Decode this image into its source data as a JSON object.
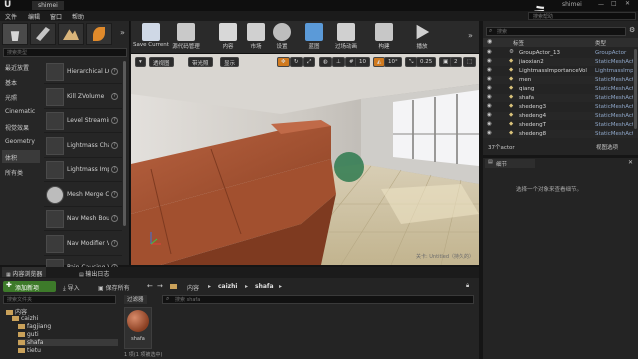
{
  "window": {
    "title": "shimei",
    "logo": "ue-logo"
  },
  "menu": [
    "文件",
    "编辑",
    "窗口",
    "帮助"
  ],
  "top_right": {
    "title": "shimei",
    "search_placeholder": "搜索帮助"
  },
  "modes_panel": {
    "search_placeholder": "搜索类型",
    "categories": [
      "最近放置",
      "基本",
      "光照",
      "Cinematic",
      "视觉效果",
      "Geometry",
      "体积",
      "所有类"
    ],
    "active_category_index": 6,
    "items": [
      "Hierarchical LOD",
      "Kill ZVolume",
      "Level Streamin",
      "Lightmass Cha",
      "Lightmass Imp",
      "Mesh Merge Cullin",
      "Nav Mesh Bou",
      "Nav Modifier V",
      "Pain Causing V"
    ]
  },
  "toolbar": {
    "buttons": [
      "Save Current",
      "源代码管理",
      "内容",
      "市场",
      "设置",
      "蓝图",
      "过场动画",
      "构建",
      "播放"
    ]
  },
  "viewport": {
    "view_mode": "透视图",
    "lit_mode": "带光照",
    "show": "显示",
    "grid_snap": "10",
    "rotate_snap": "10°",
    "scale_snap": "0.25",
    "camera_speed": "2",
    "watermark": "关卡: Untitled（持久的）"
  },
  "outliner": {
    "search_placeholder": "搜索",
    "col_label": "标签",
    "col_type": "类型",
    "rows": [
      {
        "label": "GroupActor_13",
        "type": "GroupActor"
      },
      {
        "label": "jiaoxian2",
        "type": "StaticMeshAct"
      },
      {
        "label": "LightmassImportanceVol",
        "type": "LightmassImp"
      },
      {
        "label": "men",
        "type": "StaticMeshAct"
      },
      {
        "label": "qiang",
        "type": "StaticMeshAct"
      },
      {
        "label": "shafa",
        "type": "StaticMeshAct"
      },
      {
        "label": "shedeng3",
        "type": "StaticMeshAct"
      },
      {
        "label": "shedeng4",
        "type": "StaticMeshAct"
      },
      {
        "label": "shedengT",
        "type": "StaticMeshAct"
      },
      {
        "label": "shedeng8",
        "type": "StaticMeshAct"
      }
    ],
    "count": "37个actor",
    "view_options": "视图选项"
  },
  "details": {
    "tab": "细节",
    "hint": "选择一个对象来查看细节。"
  },
  "content_browser": {
    "tabs": [
      "内容浏览器",
      "输出日志"
    ],
    "add_new": "添加新项",
    "import": "导入",
    "save_all": "保存所有",
    "breadcrumb": [
      "内容",
      "caizhi",
      "shafa"
    ],
    "folder_search_placeholder": "搜索文件夹",
    "filter": "过滤器",
    "asset_search_placeholder": "搜索 shafa",
    "folders": [
      "内容",
      "caizhi",
      "fagjiang",
      "guti",
      "shafa",
      "tietu"
    ],
    "asset_name": "shafa",
    "status": "1 项(1 项被选中)"
  }
}
